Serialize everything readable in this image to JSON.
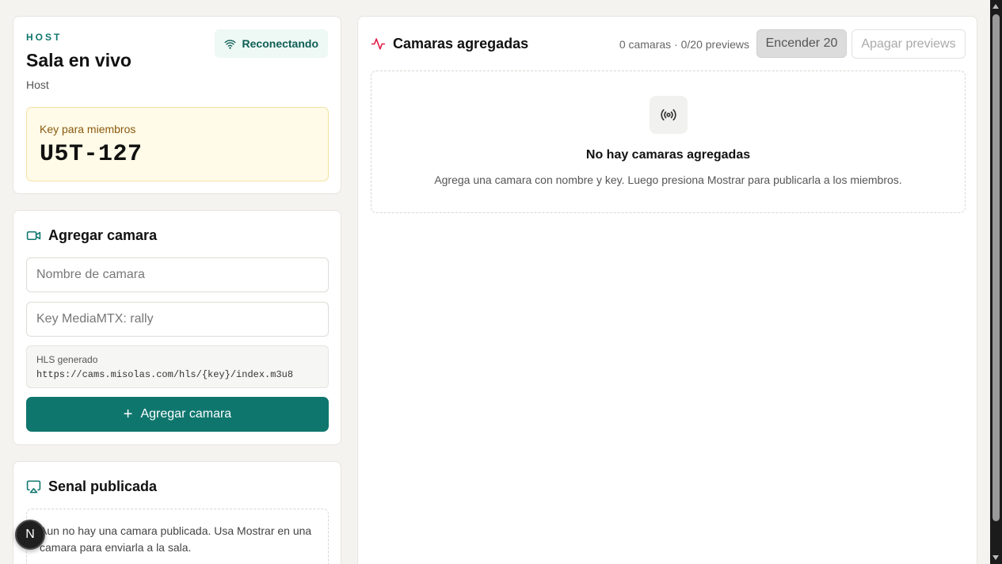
{
  "host": {
    "eyebrow": "HOST",
    "title": "Sala en vivo",
    "role": "Host",
    "status": "Reconectando",
    "status_icon": "wifi-icon",
    "key_label": "Key para miembros",
    "key_value": "U5T-127"
  },
  "add_camera": {
    "title": "Agregar camara",
    "icon": "video-camera-icon",
    "name_placeholder": "Nombre de camara",
    "key_placeholder": "Key MediaMTX: rally",
    "hls_label": "HLS generado",
    "hls_url": "https://cams.misolas.com/hls/{key}/index.m3u8",
    "button_icon": "+",
    "button_label": "Agregar camara"
  },
  "published_signal": {
    "title": "Senal publicada",
    "icon": "cast-icon",
    "empty_text": "Aun no hay una camara publicada. Usa Mostrar en una camara para enviarla a la sala."
  },
  "cameras": {
    "title": "Camaras agregadas",
    "icon": "activity-icon",
    "stats": "0 camaras · 0/20 previews",
    "turn_on_label": "Encender 20",
    "turn_off_label": "Apagar previews",
    "empty_icon": "broadcast-icon",
    "empty_title": "No hay camaras agregadas",
    "empty_description": "Agrega una camara con nombre y key. Luego presiona Mostrar para publicarla a los miembros."
  },
  "floating_badge": "N",
  "colors": {
    "accent": "#0f766e",
    "background": "#f4f3ef",
    "key_box": "#fffbe8",
    "activity_icon": "#e11d48"
  }
}
